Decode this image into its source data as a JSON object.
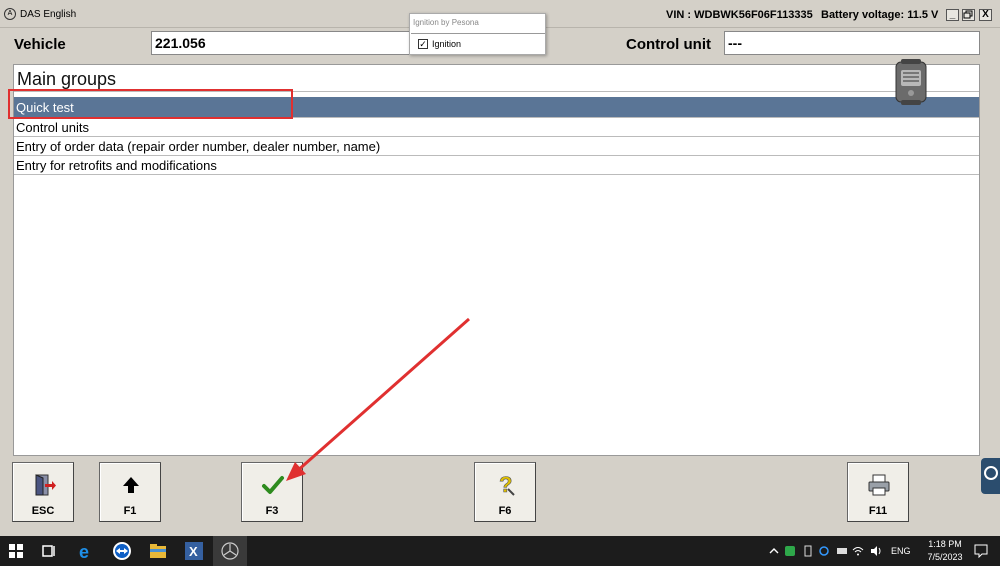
{
  "window": {
    "title": "DAS English",
    "vin": "VIN : WDBWK56F06F113335",
    "battery": "Battery voltage: 11.5 V",
    "buttons": {
      "minimize": "_",
      "restore": "🗗",
      "close": "X"
    }
  },
  "ignition_popup": {
    "title": "Ignition by Pesona",
    "option_label": "Ignition",
    "checked": true
  },
  "vehicle": {
    "label": "Vehicle",
    "value": "221.056"
  },
  "control_unit": {
    "label": "Control unit",
    "value": "---"
  },
  "main": {
    "header": "Main groups",
    "items": [
      {
        "label": "Quick test",
        "selected": true
      },
      {
        "label": "Control units",
        "selected": false
      },
      {
        "label": "Entry of order data (repair order number, dealer number, name)",
        "selected": false
      },
      {
        "label": "Entry for retrofits and modifications",
        "selected": false
      }
    ],
    "selection_color": "#5a7596"
  },
  "function_keys": [
    {
      "label": "ESC",
      "icon": "exit-door-icon"
    },
    {
      "label": "F1",
      "icon": "arrow-up-icon"
    },
    {
      "label": "F3",
      "icon": "checkmark-icon"
    },
    {
      "label": "F6",
      "icon": "help-question-icon"
    },
    {
      "label": "F11",
      "icon": "printer-icon"
    }
  ],
  "annotation": {
    "highlight_color": "#e03030"
  },
  "taskbar": {
    "apps": [
      "windows-start-icon",
      "task-view-icon",
      "edge-icon",
      "teamviewer-icon",
      "file-explorer-icon",
      "xentry-icon",
      "mercedes-star-icon"
    ],
    "language": "ENG",
    "time": "1:18 PM",
    "date": "7/5/2023"
  }
}
